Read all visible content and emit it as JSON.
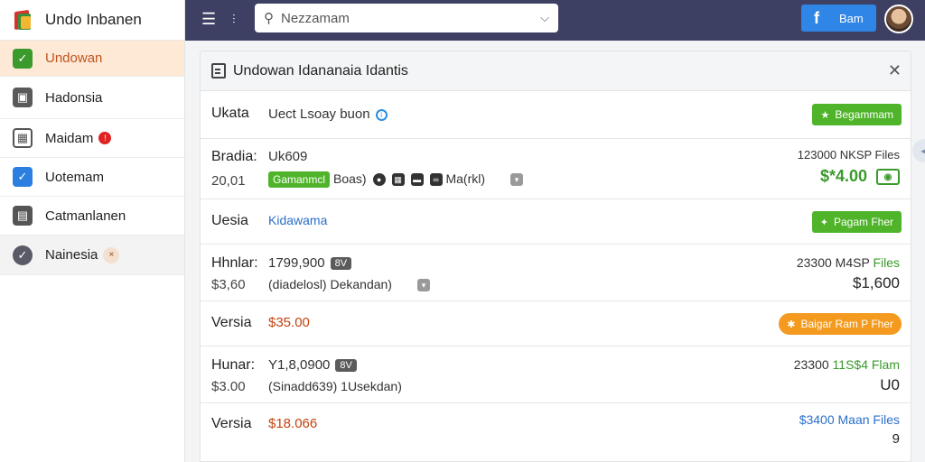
{
  "brand": {
    "title": "Undo Inbanen"
  },
  "sidebar": {
    "items": [
      {
        "label": "Undowan",
        "icon": "check-square-icon",
        "color": "#3a9a2b"
      },
      {
        "label": "Hadonsia",
        "icon": "briefcase-icon",
        "color": "#555555"
      },
      {
        "label": "Maidam",
        "icon": "calendar-icon",
        "color": "#555555",
        "badge": "!"
      },
      {
        "label": "Uotemam",
        "icon": "checkbox-icon",
        "color": "#2a7fe0"
      },
      {
        "label": "Catmanlanen",
        "icon": "archive-icon",
        "color": "#555555"
      },
      {
        "label": "Nainesia",
        "icon": "check-circle-icon",
        "color": "#555555",
        "badge": "×"
      }
    ]
  },
  "topbar": {
    "search_placeholder": "Nezzamam",
    "button_label": "Bam",
    "button_icon": "f"
  },
  "panel": {
    "title": "Undowan Idananaia Idantis",
    "rows": [
      {
        "label": "Ukata",
        "value": "Uect Lsoay buon",
        "button": "Begammam"
      },
      {
        "label": "Bradia:",
        "value": "Uk609",
        "sub": "20,01",
        "tag": "Gamanmcl",
        "tag_after": "Boas)",
        "tag_tail": "Ma(rkl)",
        "right_top": "123000 NKSP Files",
        "right_big": "$*4.00"
      },
      {
        "label": "Uesia",
        "value": "Kidawama",
        "button": "Pagam Fher"
      },
      {
        "label": "Hhnlar:",
        "value": "1799,900",
        "grey_tag": "8V",
        "sub": "$3,60",
        "sub_value": "(diadelosl) Dekandan)",
        "right_top_a": "23300 M4SP",
        "right_top_b": "Files",
        "right_big": "$1,600"
      },
      {
        "label": "Versia",
        "value": "$35.00",
        "button": "Baigar Ram P Fher"
      },
      {
        "label": "Hunar:",
        "value": "Y1,8,0900",
        "grey_tag": "8V",
        "sub": "$3.00",
        "sub_value": "(Sinadd639) 1Usekdan)",
        "right_top_a": "23300",
        "right_top_b": "11S$4 Flam",
        "right_big": "U0"
      },
      {
        "label": "Versia",
        "value": "$18.066",
        "right_top": "$3400 Maan Files",
        "right_big": "9"
      }
    ]
  }
}
